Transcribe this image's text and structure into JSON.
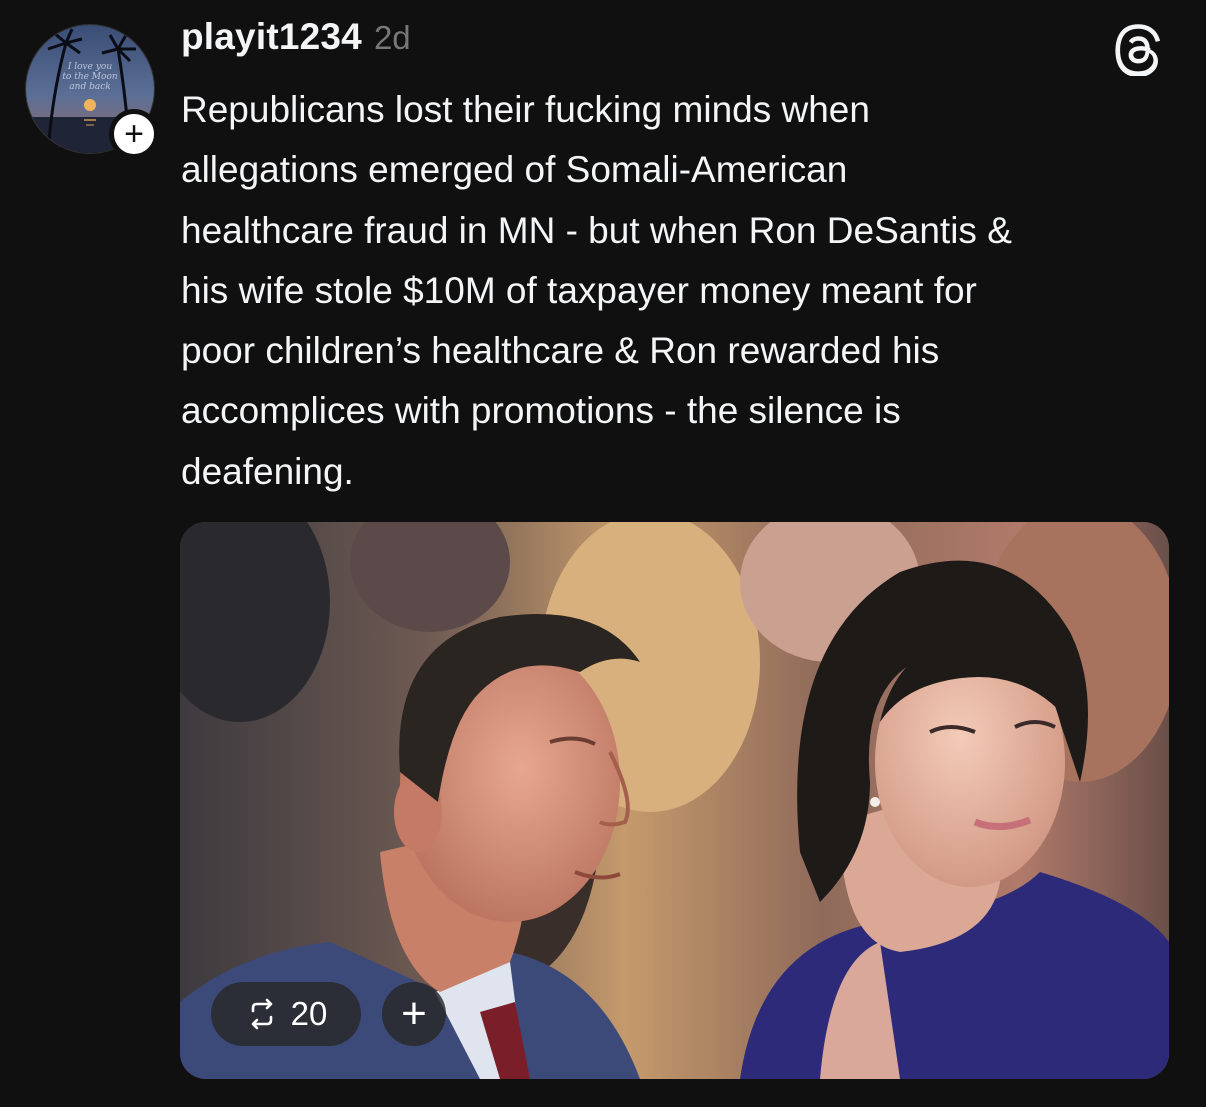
{
  "post": {
    "username": "playit1234",
    "time": "2d",
    "avatar_text": [
      "I love you",
      "to the Moon",
      "and back"
    ],
    "text": "Republicans lost their fucking minds when\nallegations emerged of Somali-American\nhealthcare fraud in MN - but when Ron DeSantis &\nhis wife stole $10M of taxpayer money meant for\npoor children’s healthcare & Ron rewarded his\naccomplices with promotions - the silence is\ndeafening.",
    "follow_label": "+",
    "media": {
      "repost_count": "20",
      "add_label": "+"
    }
  },
  "icons": {
    "threads": "threads-logo-icon",
    "repost": "repost-icon",
    "follow": "plus-icon"
  },
  "colors": {
    "background": "#101010",
    "text": "#f3f5f7",
    "muted": "#777777",
    "pill": "#282828"
  }
}
